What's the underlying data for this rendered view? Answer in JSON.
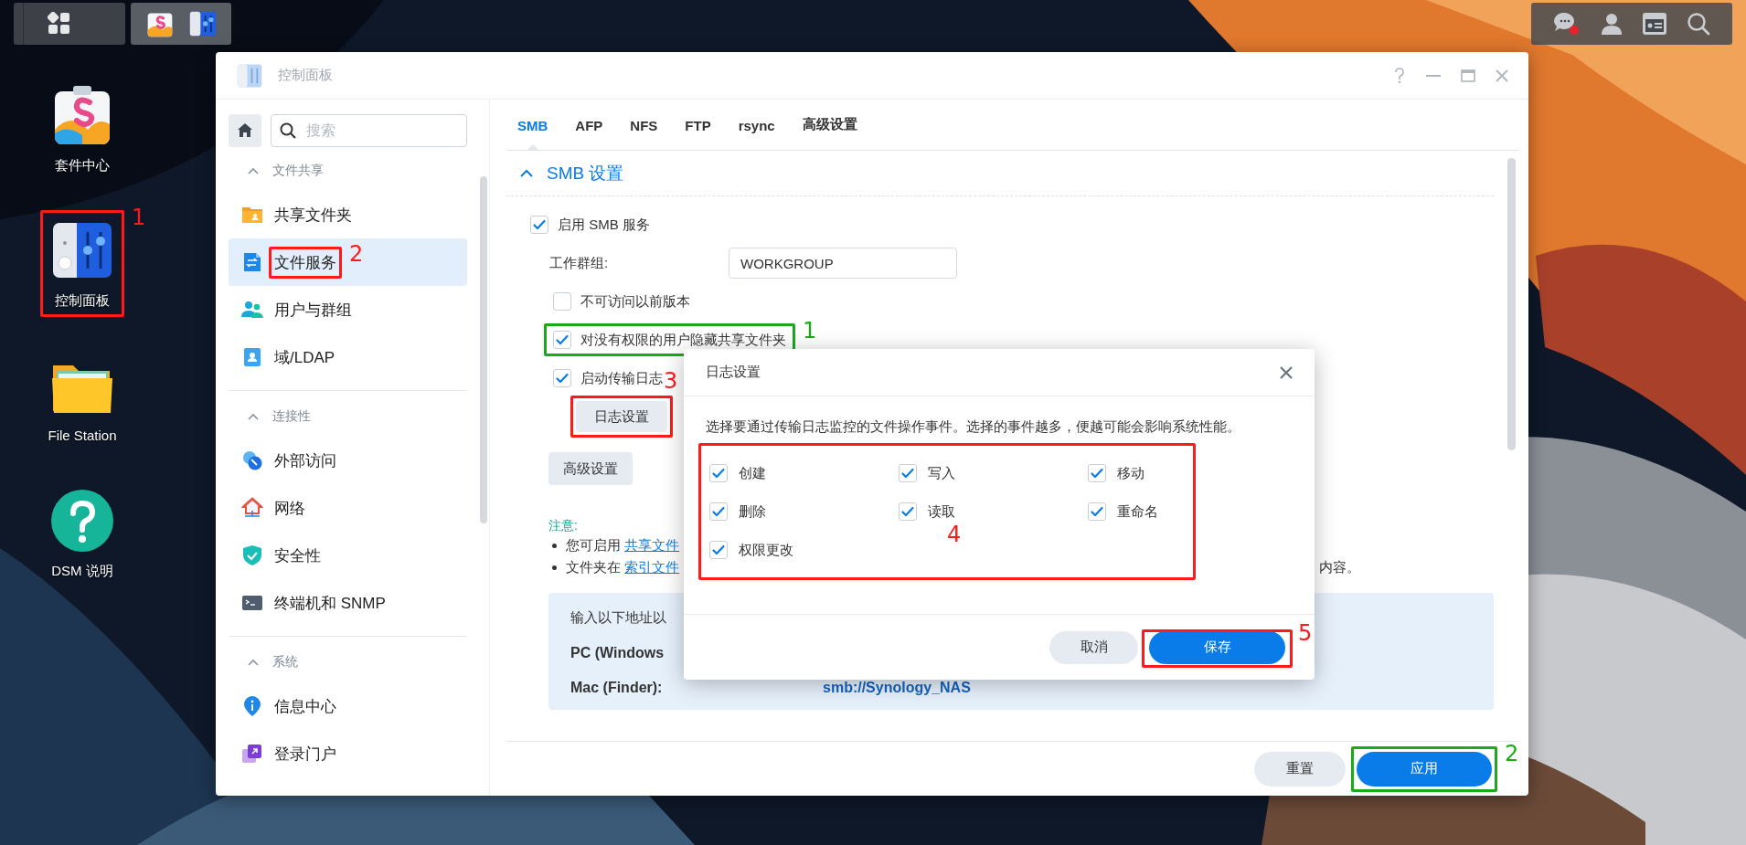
{
  "desktop_icons": [
    {
      "label": "套件中心"
    },
    {
      "label": "控制面板",
      "callout": {
        "number": "1",
        "color": "#ff1a1a"
      }
    },
    {
      "label": "File Station"
    },
    {
      "label": "DSM 说明"
    }
  ],
  "window": {
    "title": "控制面板"
  },
  "sidebar": {
    "search": {
      "placeholder": "搜索"
    },
    "sections": [
      {
        "title": "文件共享",
        "expanded": true,
        "items": [
          {
            "label": "共享文件夹",
            "selected": false
          },
          {
            "label": "文件服务",
            "selected": true,
            "callout": {
              "number": "2",
              "color": "#ff1a1a"
            }
          },
          {
            "label": "用户与群组",
            "selected": false
          },
          {
            "label": "域/LDAP",
            "selected": false
          }
        ]
      },
      {
        "title": "连接性",
        "expanded": true,
        "items": [
          {
            "label": "外部访问",
            "selected": false
          },
          {
            "label": "网络",
            "selected": false
          },
          {
            "label": "安全性",
            "selected": false
          },
          {
            "label": "终端机和 SNMP",
            "selected": false
          }
        ]
      },
      {
        "title": "系统",
        "expanded": true,
        "items": [
          {
            "label": "信息中心",
            "selected": false
          },
          {
            "label": "登录门户",
            "selected": false
          }
        ]
      }
    ]
  },
  "tabs": [
    {
      "label": "SMB",
      "selected": true
    },
    {
      "label": "AFP",
      "selected": false
    },
    {
      "label": "NFS",
      "selected": false
    },
    {
      "label": "FTP",
      "selected": false
    },
    {
      "label": "rsync",
      "selected": false
    },
    {
      "label": "高级设置",
      "selected": false
    }
  ],
  "smb_section": {
    "title": "SMB 设置",
    "expanded": true,
    "options": [
      {
        "kind": "checkbox",
        "label": "启用 SMB 服务",
        "checked": true,
        "children": [
          {
            "kind": "field",
            "label": "工作群组:",
            "value": "WORKGROUP"
          },
          {
            "kind": "checkbox",
            "label": "不可访问以前版本",
            "checked": false
          },
          {
            "kind": "checkbox",
            "label": "对没有权限的用户隐藏共享文件夹",
            "checked": true,
            "callout": {
              "number": "1",
              "color": "#1aaa1a"
            }
          },
          {
            "kind": "checkbox",
            "label": "启动传输日志",
            "checked": true,
            "children": [
              {
                "kind": "button",
                "label": "日志设置",
                "callout": {
                  "number": "3",
                  "color": "#ff1a1a"
                }
              }
            ]
          }
        ]
      }
    ],
    "advanced_button": "高级设置",
    "note": {
      "title": "注意:",
      "bullets": [
        {
          "text": "您可启用 ",
          "link": "共享文件"
        },
        {
          "text": "文件夹在 ",
          "link": "索引文件",
          "tail": "内容。"
        }
      ]
    },
    "address_box": {
      "intro": "输入以下地址以",
      "rows": [
        {
          "label": "PC (Windows"
        },
        {
          "label": "Mac (Finder):",
          "value": "smb://Synology_NAS"
        }
      ]
    }
  },
  "footer": {
    "buttons": [
      {
        "kind": "secondary",
        "label": "重置"
      },
      {
        "kind": "primary",
        "label": "应用",
        "callout": {
          "number": "2",
          "color": "#1aaa1a"
        }
      }
    ]
  },
  "dialog": {
    "title": "日志设置",
    "description": "选择要通过传输日志监控的文件操作事件。选择的事件越多，便越可能会影响系统性能。",
    "events": [
      {
        "label": "创建",
        "checked": true
      },
      {
        "label": "写入",
        "checked": true
      },
      {
        "label": "移动",
        "checked": true
      },
      {
        "label": "删除",
        "checked": true
      },
      {
        "label": "读取",
        "checked": true
      },
      {
        "label": "重命名",
        "checked": true
      },
      {
        "label": "权限更改",
        "checked": true
      }
    ],
    "events_callout": {
      "number": "4",
      "color": "#ff1a1a"
    },
    "buttons": [
      {
        "kind": "secondary",
        "label": "取消"
      },
      {
        "kind": "primary",
        "label": "保存",
        "callout": {
          "number": "5",
          "color": "#ff1a1a"
        }
      }
    ]
  }
}
